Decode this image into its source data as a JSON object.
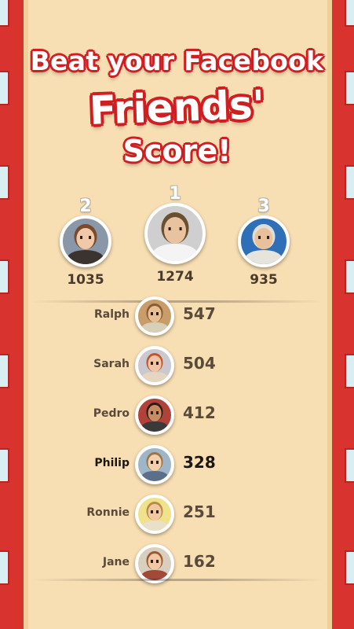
{
  "headline": {
    "line1": "Beat your Facebook",
    "line2": "Friends'",
    "line3": "Score!"
  },
  "podium": [
    {
      "rank": "2",
      "score": "1035",
      "avatar_icon": "woman-glasses-avatar",
      "bg": "#8a97a8",
      "skin": "#f1c9a8",
      "hair": "#7a4a2a",
      "shirt": "#3b3330"
    },
    {
      "rank": "1",
      "score": "1274",
      "avatar_icon": "man-beard-avatar",
      "bg": "#cfcfcf",
      "skin": "#e9c3a0",
      "hair": "#6b5030",
      "shirt": "#f4f4f4"
    },
    {
      "rank": "3",
      "score": "935",
      "avatar_icon": "hooded-man-avatar",
      "bg": "#2e6fb7",
      "skin": "#e8c09c",
      "hair": "#e0ded8",
      "shirt": "#e7e4dc"
    }
  ],
  "leaderboard": [
    {
      "name": "Ralph",
      "score": "547",
      "avatar_icon": "ralph-avatar",
      "bg": "#c99d6a",
      "skin": "#e7bf95",
      "hair": "#8a5c32",
      "shirt": "#d8cfb8"
    },
    {
      "name": "Sarah",
      "score": "504",
      "avatar_icon": "sarah-avatar",
      "bg": "#c9c9cf",
      "skin": "#f0c4a6",
      "hair": "#c2552a",
      "shirt": "#e6d5c0"
    },
    {
      "name": "Pedro",
      "score": "412",
      "avatar_icon": "pedro-avatar",
      "bg": "#b0423a",
      "skin": "#c98b62",
      "hair": "#2c1c14",
      "shirt": "#3a3a3a"
    },
    {
      "name": "Philip",
      "score": "328",
      "avatar_icon": "philip-avatar",
      "bg": "#9fb6c8",
      "skin": "#f2cfae",
      "hair": "#9b7645",
      "shirt": "#5b6f8a",
      "me": true
    },
    {
      "name": "Ronnie",
      "score": "251",
      "avatar_icon": "ronnie-avatar",
      "bg": "#efe28a",
      "skin": "#f0c9a2",
      "hair": "#b98a4a",
      "shirt": "#e8e0c8"
    },
    {
      "name": "Jane",
      "score": "162",
      "avatar_icon": "jane-avatar",
      "bg": "#d9cfbf",
      "skin": "#f1c7a5",
      "hair": "#9a5a30",
      "shirt": "#a24a3a"
    }
  ]
}
